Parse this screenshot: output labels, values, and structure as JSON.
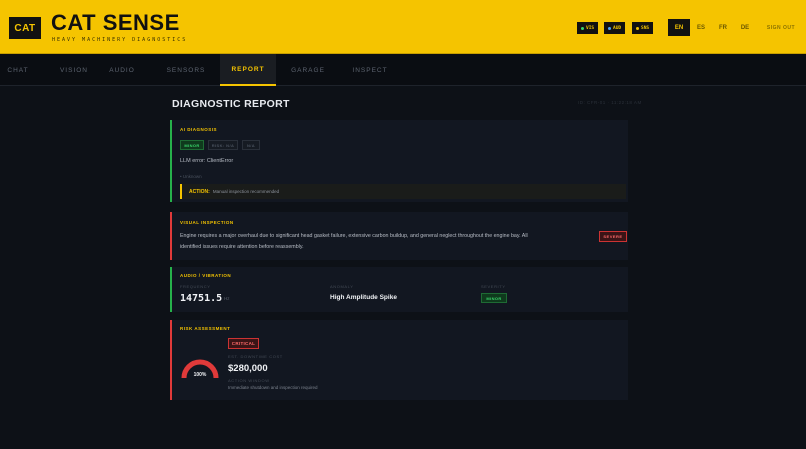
{
  "header": {
    "logo_text": "CAT",
    "title": "CAT SENSE",
    "subtitle": "HEAVY MACHINERY DIAGNOSTICS",
    "status_chips": [
      {
        "label": "VIS",
        "dot_color": "#3ad46a"
      },
      {
        "label": "AUD",
        "dot_color": "#4aa3ff"
      },
      {
        "label": "SNS",
        "dot_color": "#f5c400"
      }
    ],
    "languages": [
      "EN",
      "ES",
      "FR",
      "DE"
    ],
    "active_language": "EN",
    "sign_out": "SIGN OUT"
  },
  "nav": {
    "tabs": [
      "CHAT",
      "VISION",
      "AUDIO",
      "SENSORS",
      "REPORT",
      "GARAGE",
      "INSPECT"
    ],
    "active_tab": "REPORT"
  },
  "report": {
    "title": "DIAGNOSTIC REPORT",
    "meta": "ID: CFR-01 · 11:22:18 AM",
    "ai_diagnosis": {
      "label": "AI DIAGNOSIS",
      "badges": [
        "MINOR",
        "RISK: N/A",
        "N/A"
      ],
      "error_text": "LLM error: ClientError",
      "detail": "• Unknown",
      "action_label": "ACTION:",
      "action_text": "Manual inspection recommended"
    },
    "visual_inspection": {
      "label": "VISUAL INSPECTION",
      "text_line1": "Engine requires a major overhaul due to significant head gasket failure, extensive carbon buildup, and general neglect throughout the engine bay. All",
      "text_line2": "identified issues require attention before reassembly.",
      "severity": "SEVERE"
    },
    "audio_vibration": {
      "label": "AUDIO / VIBRATION",
      "frequency_label": "FREQUENCY",
      "frequency_value": "14751.5",
      "frequency_unit": "Hz",
      "anomaly_label": "ANOMALY",
      "anomaly_value": "High Amplitude Spike",
      "severity_label": "SEVERITY",
      "severity_value": "MINOR"
    },
    "risk_assessment": {
      "label": "RISK ASSESSMENT",
      "level": "CRITICAL",
      "gauge_value": "100%",
      "gauge_fraction": 1.0,
      "downtime_label": "EST. DOWNTIME COST",
      "downtime_value": "$280,000",
      "action_window_label": "ACTION WINDOW",
      "action_window_value": "Immediate shutdown and inspection required"
    }
  },
  "colors": {
    "accent": "#f5c400",
    "ok": "#26b24b",
    "danger": "#e03a3a"
  }
}
